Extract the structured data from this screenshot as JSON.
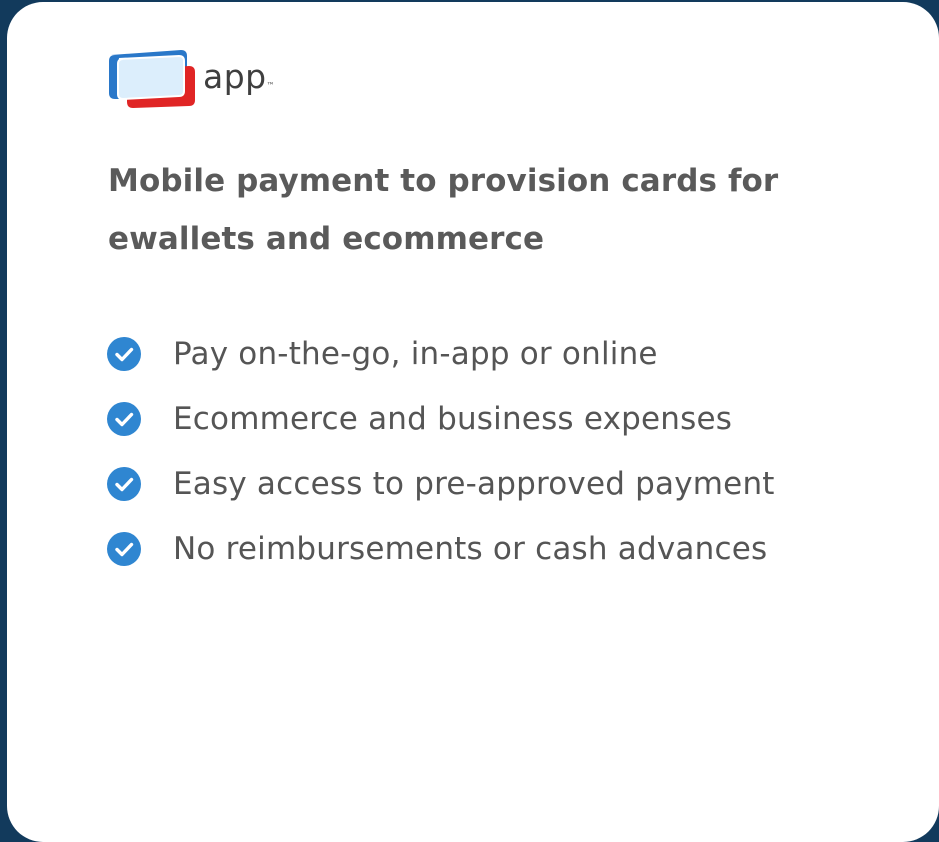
{
  "colors": {
    "background": "#123a5c",
    "card": "#ffffff",
    "check": "#2f86d1",
    "heading": "#5a5a5a",
    "text": "#555555",
    "logo_blue": "#2a78c9",
    "logo_red": "#e02525",
    "logo_light": "#dceefc"
  },
  "logo": {
    "icon": "card-stack-logo-icon",
    "text": "app",
    "mark": "™"
  },
  "headline": "Mobile payment to provision cards for ewallets and ecommerce",
  "features": [
    {
      "icon": "check-circle-icon",
      "text": "Pay on-the-go, in-app or online"
    },
    {
      "icon": "check-circle-icon",
      "text": "Ecommerce and business expenses"
    },
    {
      "icon": "check-circle-icon",
      "text": "Easy access to pre-approved payment"
    },
    {
      "icon": "check-circle-icon",
      "text": "No reimbursements or cash advances"
    }
  ]
}
